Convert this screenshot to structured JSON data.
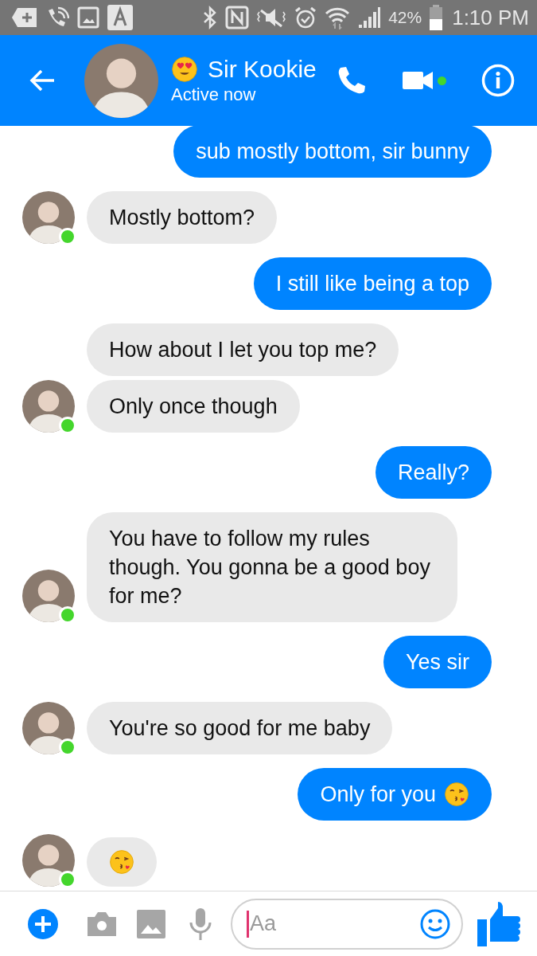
{
  "status_bar": {
    "battery": "42%",
    "time": "1:10 PM"
  },
  "header": {
    "title": "Sir Kookie",
    "subtitle": "Active now",
    "active": true
  },
  "messages": [
    {
      "sent": true,
      "kind": "text",
      "text": "sub mostly bottom, sir bunny"
    },
    {
      "sent": false,
      "kind": "text",
      "text": "Mostly bottom?",
      "avatar": true
    },
    {
      "sent": true,
      "kind": "text",
      "text": "I still like being a top"
    },
    {
      "sent": false,
      "kind": "text",
      "text": "How about I let you top me?",
      "avatar": false
    },
    {
      "sent": false,
      "kind": "text",
      "text": "Only once though",
      "avatar": true
    },
    {
      "sent": true,
      "kind": "text",
      "text": "Really?"
    },
    {
      "sent": false,
      "kind": "text",
      "text": "You have to follow my rules though. You gonna be a good boy for me?",
      "avatar": true
    },
    {
      "sent": true,
      "kind": "text",
      "text": "Yes sir"
    },
    {
      "sent": false,
      "kind": "text",
      "text": "You're so good for me baby",
      "avatar": true
    },
    {
      "sent": true,
      "kind": "text_kiss",
      "text": "Only for you"
    },
    {
      "sent": false,
      "kind": "kiss",
      "avatar": true
    }
  ],
  "composer": {
    "placeholder": "Aa",
    "focused": true
  }
}
